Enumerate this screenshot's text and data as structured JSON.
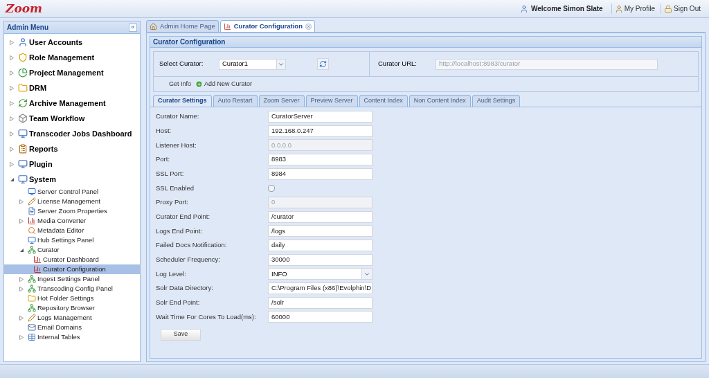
{
  "header": {
    "logo": "Zoom",
    "welcome": "Welcome Simon Slate",
    "links": [
      "My Profile",
      "Sign Out"
    ]
  },
  "sidebar": {
    "title": "Admin Menu",
    "collapse": "«",
    "items": [
      {
        "label": "User Accounts",
        "kind": "branch",
        "expanded": false,
        "selected": false
      },
      {
        "label": "Role Management",
        "kind": "branch",
        "expanded": false,
        "selected": false
      },
      {
        "label": "Project Management",
        "kind": "branch",
        "expanded": false,
        "selected": false
      },
      {
        "label": "DRM",
        "kind": "branch",
        "expanded": false,
        "selected": false
      },
      {
        "label": "Archive Management",
        "kind": "branch",
        "expanded": false,
        "selected": false
      },
      {
        "label": "Team Workflow",
        "kind": "branch",
        "expanded": false,
        "selected": false
      },
      {
        "label": "Transcoder Jobs Dashboard",
        "kind": "branch",
        "expanded": false,
        "selected": false
      },
      {
        "label": "Reports",
        "kind": "branch",
        "expanded": false,
        "selected": false
      },
      {
        "label": "Plugin",
        "kind": "branch",
        "expanded": false,
        "selected": false
      },
      {
        "label": "System",
        "kind": "branch",
        "expanded": true,
        "selected": false,
        "children": [
          {
            "label": "Server Control Panel",
            "kind": "leaf",
            "selected": false
          },
          {
            "label": "License Management",
            "kind": "branch",
            "expanded": false,
            "selected": false
          },
          {
            "label": "Server Zoom Properties",
            "kind": "leaf",
            "selected": false
          },
          {
            "label": "Media Converter",
            "kind": "branch",
            "expanded": false,
            "selected": false
          },
          {
            "label": "Metadata Editor",
            "kind": "leaf",
            "selected": false
          },
          {
            "label": "Hub Settings Panel",
            "kind": "leaf",
            "selected": false
          },
          {
            "label": "Curator",
            "kind": "branch",
            "expanded": true,
            "selected": false,
            "children": [
              {
                "label": "Curator Dashboard",
                "kind": "leaf",
                "selected": false
              },
              {
                "label": "Curator Configuration",
                "kind": "leaf",
                "selected": true
              }
            ]
          },
          {
            "label": "Ingest Settings Panel",
            "kind": "branch",
            "expanded": false,
            "selected": false
          },
          {
            "label": "Transcoding Config Panel",
            "kind": "branch",
            "expanded": false,
            "selected": false
          },
          {
            "label": "Hot Folder Settings",
            "kind": "leaf",
            "selected": false
          },
          {
            "label": "Repository Browser",
            "kind": "leaf",
            "selected": false
          },
          {
            "label": "Logs Management",
            "kind": "branch",
            "expanded": false,
            "selected": false
          },
          {
            "label": "Email Domains",
            "kind": "leaf",
            "selected": false
          },
          {
            "label": "Internal Tables",
            "kind": "branch",
            "expanded": false,
            "selected": false
          }
        ]
      }
    ]
  },
  "tabs": [
    {
      "label": "Admin Home Page",
      "selected": false,
      "closable": false
    },
    {
      "label": "Curator Configuration",
      "selected": true,
      "closable": true
    }
  ],
  "panel": {
    "title": "Curator Configuration",
    "select_label": "Select Curator:",
    "select_value": "Curator1",
    "url_label": "Curator URL:",
    "url_value": "http://localhost:8983/curator",
    "get_info": "Get Info",
    "add_new": "Add New Curator"
  },
  "subtabs": [
    {
      "label": "Curator Settings",
      "selected": true
    },
    {
      "label": "Auto Restart",
      "selected": false
    },
    {
      "label": "Zoom Server",
      "selected": false
    },
    {
      "label": "Preview Server",
      "selected": false
    },
    {
      "label": "Content Index",
      "selected": false
    },
    {
      "label": "Non Content Index",
      "selected": false
    },
    {
      "label": "Audit Settings",
      "selected": false
    }
  ],
  "form": [
    {
      "label": "Curator Name:",
      "kind": "text",
      "value": "CuratorServer",
      "disabled": false
    },
    {
      "label": "Host:",
      "kind": "text",
      "value": "192.168.0.247",
      "disabled": false
    },
    {
      "label": "Listener Host:",
      "kind": "text",
      "value": "0.0.0.0",
      "disabled": true
    },
    {
      "label": "Port:",
      "kind": "text",
      "value": "8983",
      "disabled": false
    },
    {
      "label": "SSL Port:",
      "kind": "text",
      "value": "8984",
      "disabled": false
    },
    {
      "label": "SSL Enabled",
      "kind": "checkbox",
      "checked": false
    },
    {
      "label": "Proxy Port:",
      "kind": "text",
      "value": "0",
      "disabled": true
    },
    {
      "label": "Curator End Point:",
      "kind": "text",
      "value": "/curator",
      "disabled": false
    },
    {
      "label": "Logs End Point:",
      "kind": "text",
      "value": "/logs",
      "disabled": false
    },
    {
      "label": "Failed Docs Notification:",
      "kind": "text",
      "value": "daily",
      "disabled": false
    },
    {
      "label": "Scheduler Frequency:",
      "kind": "text",
      "value": "30000",
      "disabled": false
    },
    {
      "label": "Log Level:",
      "kind": "select",
      "value": "INFO"
    },
    {
      "label": "Solr Data Directory:",
      "kind": "text",
      "value": "C:\\Program Files (x86)\\Evolphin\\D",
      "disabled": false
    },
    {
      "label": "Solr End Point:",
      "kind": "text",
      "value": "/solr",
      "disabled": false
    },
    {
      "label": "Wait Time For Cores To Load(ms):",
      "kind": "text",
      "value": "60000",
      "disabled": false
    }
  ],
  "save": "Save"
}
